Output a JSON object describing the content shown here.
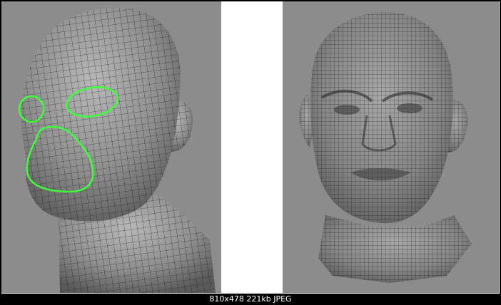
{
  "image_info": {
    "caption": "810x478  221kb  JPEG"
  },
  "colors": {
    "background": "#000000",
    "canvas": "#ffffff",
    "viewport": "#8c8c8c",
    "mesh_fill": "#8a8a8a",
    "mesh_line": "#1e1e1e",
    "highlight": "#3cff3c"
  },
  "left_panel": {
    "highlighted_regions": [
      "right-eye",
      "left-eye",
      "nose-mouth"
    ]
  }
}
